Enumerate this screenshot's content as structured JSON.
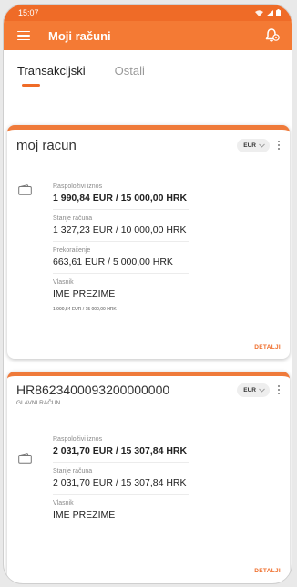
{
  "status_bar": {
    "time": "15:07"
  },
  "app_bar": {
    "title": "Moji računi",
    "menu_icon": "hamburger-icon",
    "bell_icon": "bell-settings-icon"
  },
  "tabs": [
    {
      "label": "Transakcijski",
      "active": true
    },
    {
      "label": "Ostali",
      "active": false
    }
  ],
  "accounts": [
    {
      "name": "moj racun",
      "subtitle": "",
      "currency": "EUR",
      "available_label": "Raspoloživi iznos",
      "available_value": "1 990,84 EUR / 15 000,00 HRK",
      "balance_label": "Stanje računa",
      "balance_value": "1 327,23 EUR / 10 000,00 HRK",
      "overdraft_label": "Prekoračenje",
      "overdraft_value": "663,61 EUR / 5 000,00 HRK",
      "owner_label": "Vlasnik",
      "owner_value": "IME PREZIME",
      "note": "1 990,84 EUR / 15 000,00 HRK",
      "details_label": "DETALJI"
    },
    {
      "name": "HR8623400093200000000",
      "subtitle": "GLAVNI RAČUN",
      "currency": "EUR",
      "available_label": "Raspoloživi iznos",
      "available_value": "2 031,70 EUR / 15 307,84 HRK",
      "balance_label": "Stanje računa",
      "balance_value": "2 031,70 EUR / 15 307,84 HRK",
      "owner_label": "Vlasnik",
      "owner_value": "IME PREZIME",
      "details_label": "DETALJI"
    }
  ],
  "colors": {
    "accent": "#ef6b27",
    "appbar": "#f47a34"
  }
}
